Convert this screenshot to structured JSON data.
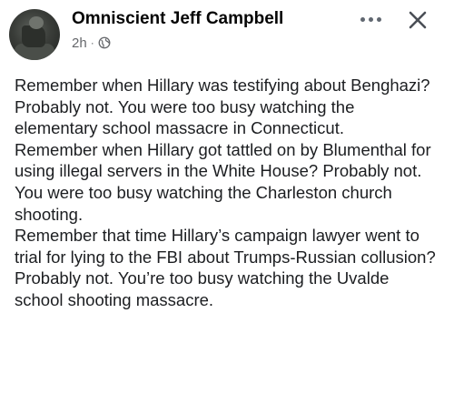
{
  "post": {
    "author_name": "Omniscient Jeff Campbell",
    "timestamp": "2h",
    "separator": "·",
    "privacy_icon": "globe-icon",
    "more_icon": "more-options-icon",
    "close_icon": "close-icon",
    "paragraphs": [
      "Remember when Hillary was testifying about Benghazi? Probably not. You were too busy watching the elementary school massacre in Connecticut.",
      "Remember when Hillary got tattled on by Blumenthal for using illegal servers in the White House? Probably not. You were too busy watching the Charleston church shooting.",
      "Remember that time Hillary’s campaign lawyer went to trial for lying to the FBI about Trumps-Russian collusion? Probably not. You’re too busy watching the Uvalde school shooting massacre."
    ]
  },
  "colors": {
    "text": "#1c1e21",
    "secondary_text": "#65676b",
    "icon": "#606770"
  }
}
